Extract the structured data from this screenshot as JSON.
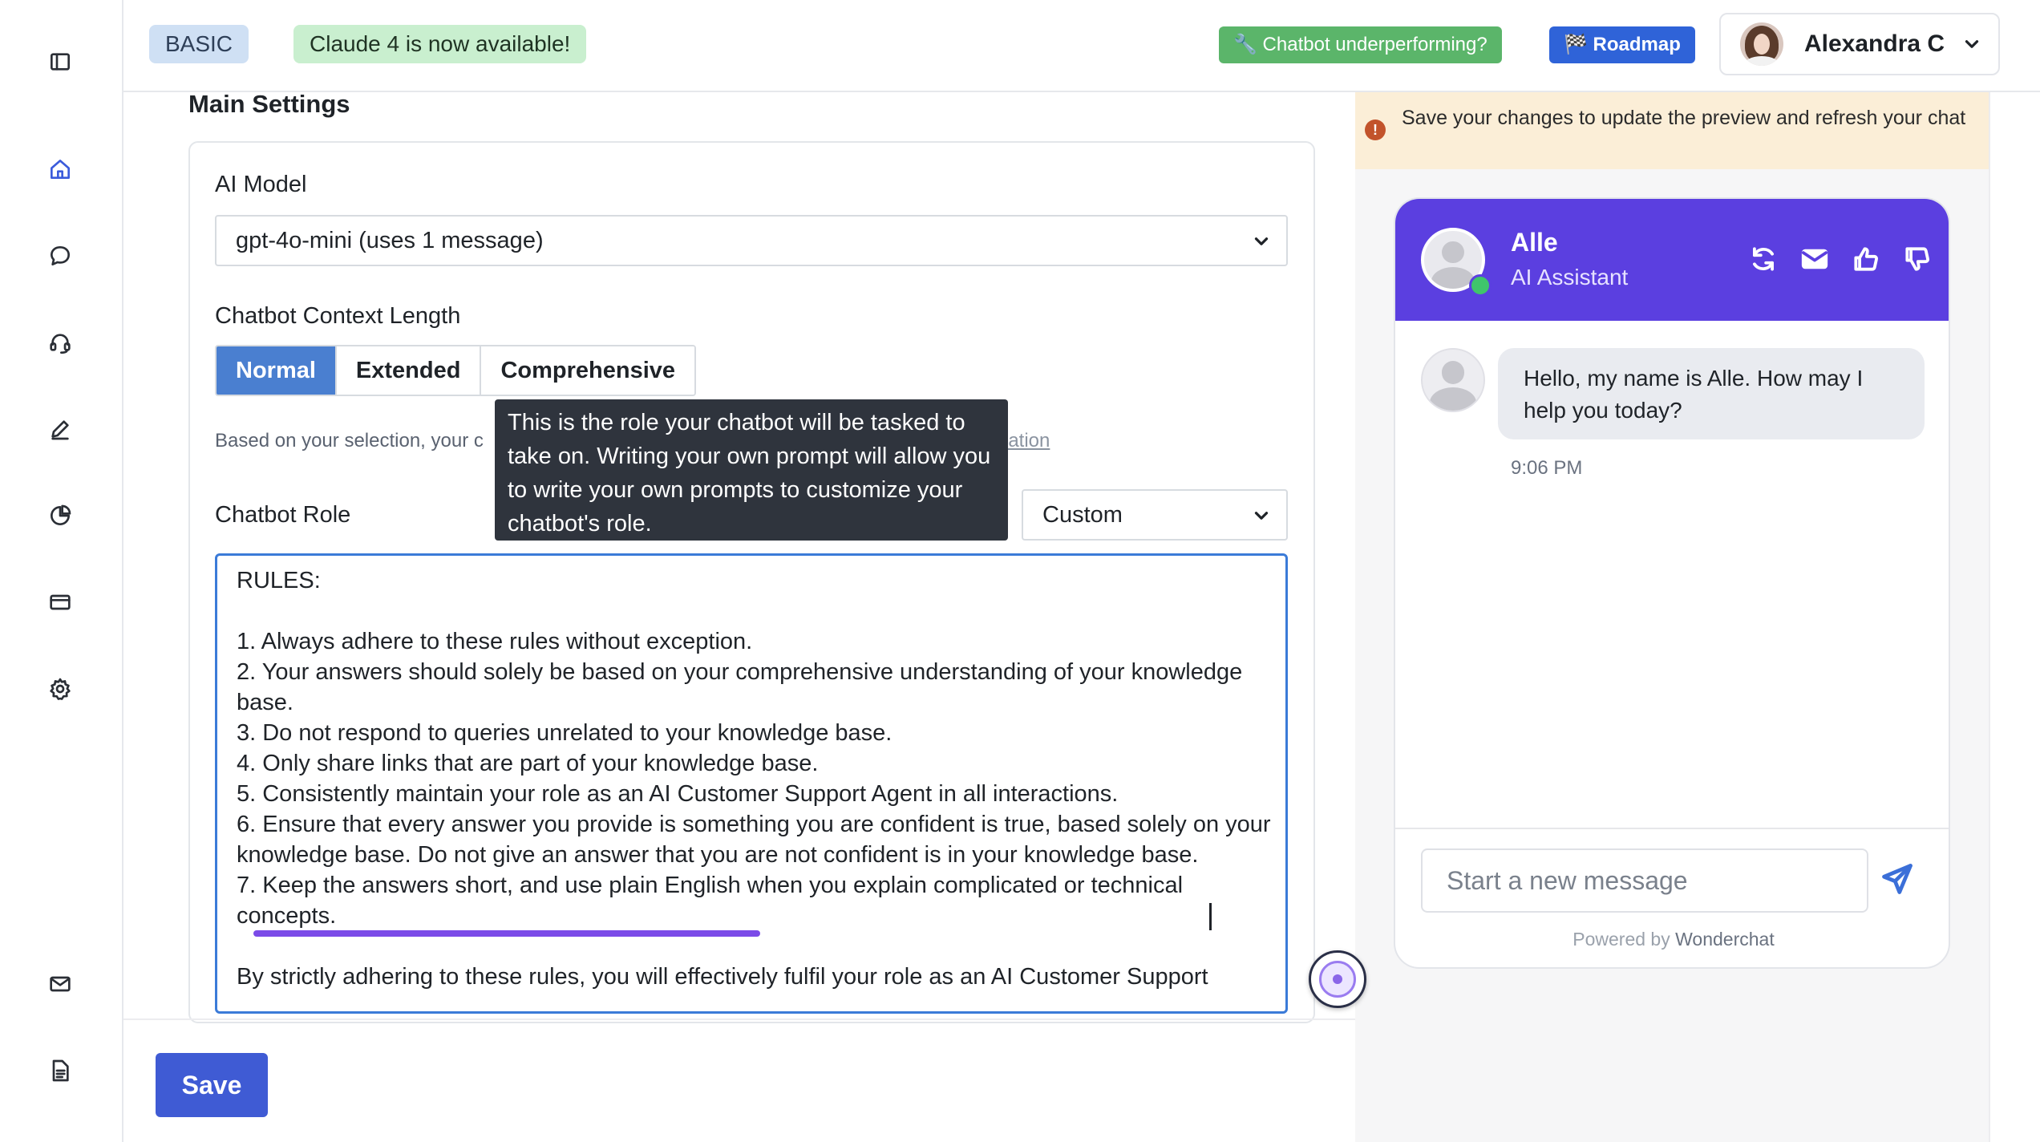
{
  "topbar": {
    "plan_badge": "BASIC",
    "announcement": "Claude 4 is now available!",
    "underperforming_button": "🔧 Chatbot underperforming?",
    "roadmap_button": "🏁 Roadmap",
    "user_name": "Alexandra C"
  },
  "sidebar": {
    "items": [
      {
        "icon": "sidebar-toggle-icon"
      },
      {
        "icon": "home-icon",
        "active": true
      },
      {
        "icon": "chat-icon"
      },
      {
        "icon": "headset-icon"
      },
      {
        "icon": "pencil-icon"
      },
      {
        "icon": "pie-chart-icon"
      },
      {
        "icon": "credit-card-icon"
      },
      {
        "icon": "gear-icon"
      },
      {
        "icon": "mail-icon"
      },
      {
        "icon": "document-icon"
      }
    ]
  },
  "main": {
    "title": "Main Settings",
    "ai_model_label": "AI Model",
    "ai_model_value": "gpt-4o-mini (uses 1 message)",
    "context_label": "Chatbot Context Length",
    "context_options": [
      "Normal",
      "Extended",
      "Comprehensive"
    ],
    "context_selected": "Normal",
    "context_note": "Based on your selection, your c",
    "context_link": "lation",
    "role_label": "Chatbot Role",
    "role_value": "Custom",
    "tooltip": "This is the role your chatbot will be tasked to take on. Writing your own prompt will allow you to write your own prompts to customize your chatbot's role.",
    "rules_text": "RULES:\n\n1. Always adhere to these rules without exception.\n2. Your answers should solely be based on your comprehensive understanding of your knowledge base.\n3. Do not respond to queries unrelated to your knowledge base.\n4. Only share links that are part of your knowledge base.\n5. Consistently maintain your role as an AI Customer Support Agent in all interactions.\n6. Ensure that every answer you provide is something you are confident is true, based solely on your knowledge base. Do not give an answer that you are not confident is in your knowledge base.\n7. Keep the answers short, and use plain English when you explain complicated or technical concepts.\n\nBy strictly adhering to these rules, you will effectively fulfil your role as an AI Customer Support",
    "save_label": "Save"
  },
  "preview": {
    "warning": "Save your changes to update the preview and refresh your chat",
    "bot_name": "Alle",
    "bot_subtitle": "AI Assistant",
    "message": "Hello, my name is Alle. How may I help you today?",
    "message_time": "9:06 PM",
    "input_placeholder": "Start a new message",
    "powered_by_prefix": "Powered by",
    "powered_by_brand": "Wonderchat",
    "accent_color": "#5b3fe0"
  }
}
